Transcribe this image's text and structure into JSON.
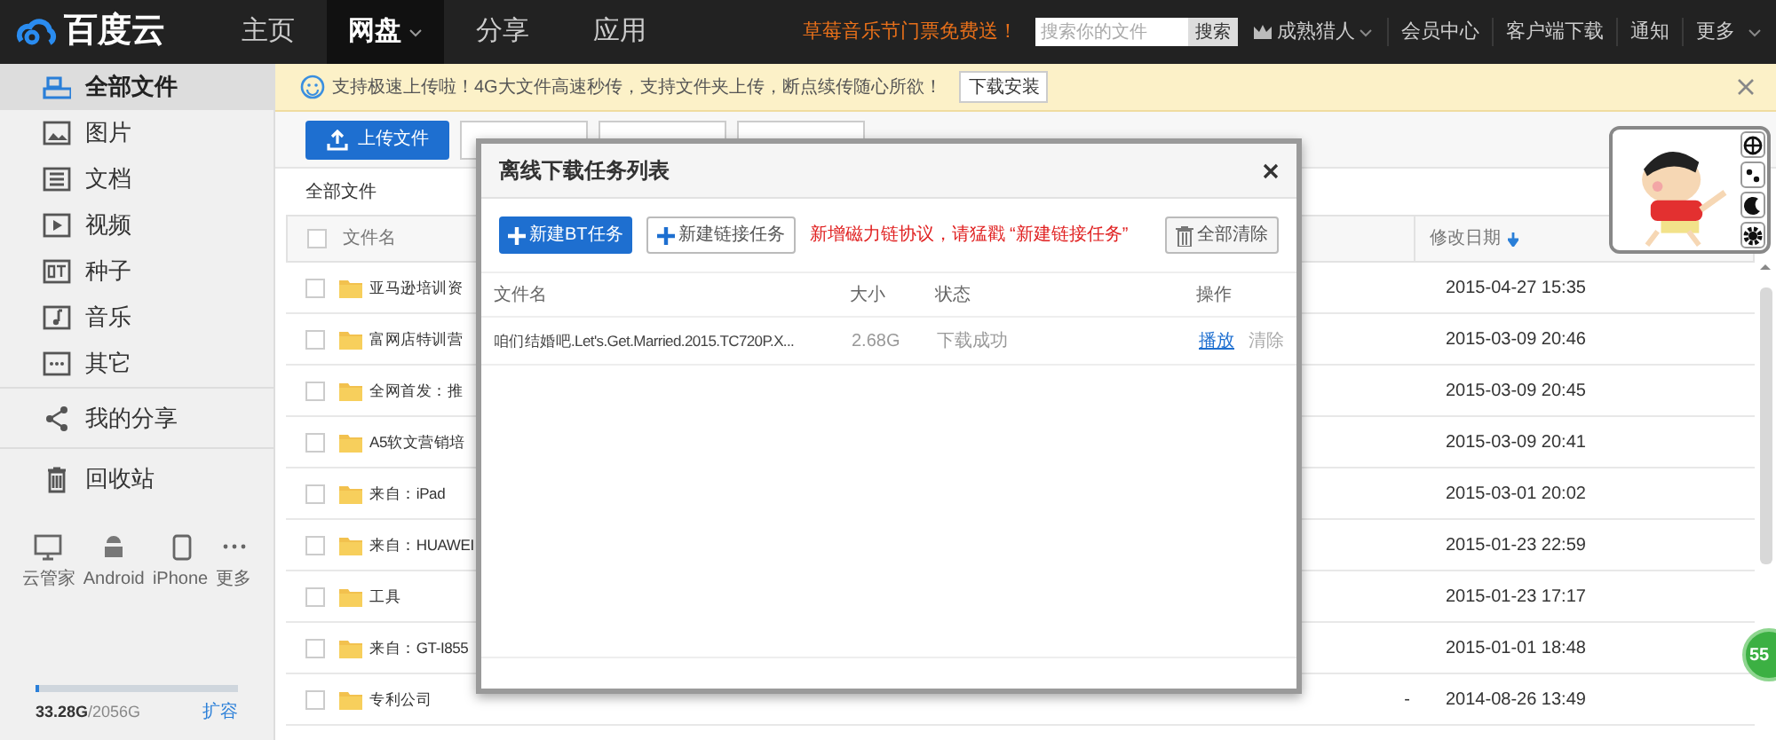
{
  "top_nav": {
    "logo": "百度云",
    "items": [
      {
        "label": "主页",
        "selected": false
      },
      {
        "label": "网盘",
        "selected": true
      },
      {
        "label": "分享",
        "selected": false
      },
      {
        "label": "应用",
        "selected": false
      }
    ],
    "promo": "草莓音乐节门票免费送！",
    "search": {
      "placeholder": "搜索你的文件",
      "button": "搜索"
    },
    "user": "成熟猎人",
    "links": [
      "会员中心",
      "客户端下载",
      "通知",
      "更多"
    ]
  },
  "notice": {
    "text": "支持极速上传啦！4G大文件高速秒传，支持文件夹上传，断点续传随心所欲！",
    "button": "下载安装"
  },
  "sidebar": {
    "items": [
      {
        "label": "全部文件",
        "selected": true
      },
      {
        "label": "图片",
        "selected": false
      },
      {
        "label": "文档",
        "selected": false
      },
      {
        "label": "视频",
        "selected": false
      },
      {
        "label": "种子",
        "selected": false
      },
      {
        "label": "音乐",
        "selected": false
      },
      {
        "label": "其它",
        "selected": false
      }
    ],
    "extra": [
      {
        "label": "我的分享"
      },
      {
        "label": "回收站"
      }
    ],
    "devices": [
      "云管家",
      "Android",
      "iPhone",
      "更多"
    ],
    "storage": {
      "used": "33.28G",
      "total": "/2056G",
      "level": 0.016,
      "expand": "扩容"
    }
  },
  "toolbar": {
    "upload": "上传文件"
  },
  "breadcrumb": "全部文件",
  "table": {
    "columns": [
      "文件名",
      "修改日期"
    ],
    "all_checked": false,
    "rows": [
      {
        "name": "亚马逊培训资",
        "date": "2015-04-27 15:35",
        "checked": false
      },
      {
        "name": "富网店特训营",
        "date": "2015-03-09 20:46",
        "checked": false
      },
      {
        "name": "全网首发：推",
        "date": "2015-03-09 20:45",
        "checked": false
      },
      {
        "name": "A5软文营销培",
        "date": "2015-03-09 20:41",
        "checked": false
      },
      {
        "name": "来自：iPad",
        "date": "2015-03-01 20:02",
        "checked": false
      },
      {
        "name": "来自：HUAWEI",
        "date": "2015-01-23 22:59",
        "checked": false
      },
      {
        "name": "工具",
        "date": "2015-01-23 17:17",
        "checked": false
      },
      {
        "name": "来自：GT-I855",
        "date": "2015-01-01 18:48",
        "checked": false
      },
      {
        "name": "专利公司",
        "size": "-",
        "date": "2014-08-26 13:49",
        "checked": false
      }
    ]
  },
  "modal": {
    "title": "离线下载任务列表",
    "bt_button": "新建BT任务",
    "link_button": "新建链接任务",
    "hint": "新增磁力链协议，请猛戳 “新建链接任务”",
    "clear_button": "全部清除",
    "columns": [
      "文件名",
      "大小",
      "状态",
      "操作"
    ],
    "tasks": [
      {
        "name": "咱们结婚吧.Let's.Get.Married.2015.TC720P.X...",
        "size": "2.68G",
        "status": "下载成功",
        "actions": [
          "播放",
          "清除"
        ]
      }
    ]
  },
  "badge": "55"
}
